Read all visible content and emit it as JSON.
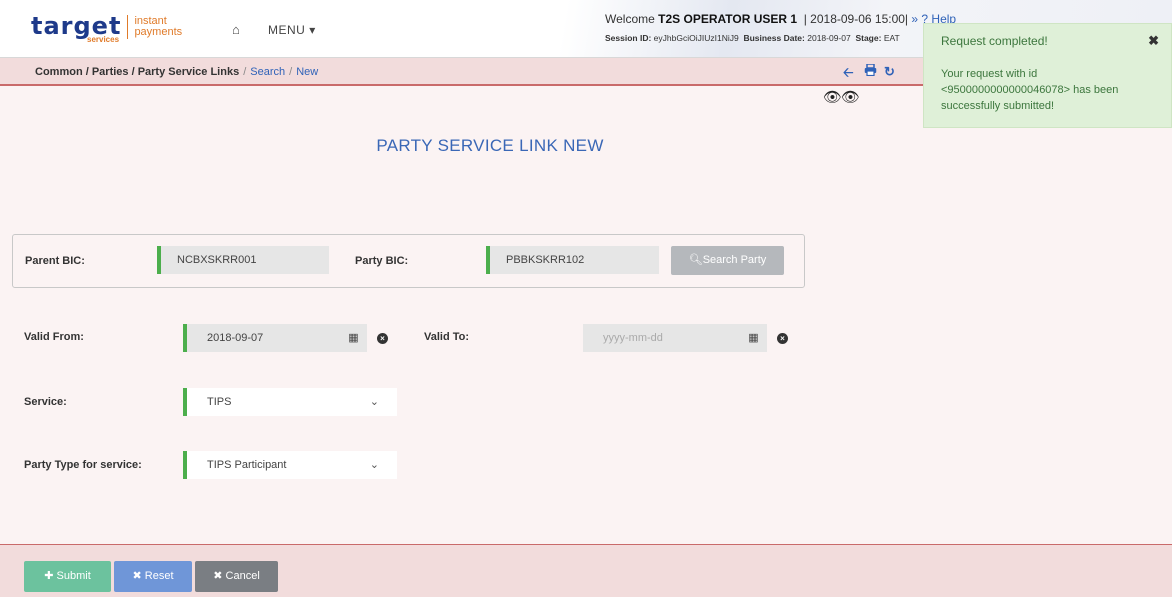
{
  "header": {
    "logo_word": "target",
    "logo_sub": "services",
    "logo_tag_1": "instant",
    "logo_tag_2": "payments",
    "home_icon": "home-icon",
    "menu_label": "MENU",
    "welcome_prefix": "Welcome",
    "user_name": "T2S OPERATOR USER 1",
    "datetime": "| 2018-09-06 15:00|",
    "help_label": "» ? Help",
    "session_label": "Session ID:",
    "session_id": "eyJhbGciOiJIUzI1NiJ9",
    "business_date_label": "Business Date:",
    "business_date": "2018-09-07",
    "stage_label": "Stage:",
    "stage": "EAT"
  },
  "breadcrumb": {
    "path": "Common / Parties / Party Service Links",
    "search": "Search",
    "new": "New"
  },
  "toolbar": {
    "back_icon": "arrow-left-icon",
    "print_icon": "print-icon",
    "refresh_icon": "refresh-icon"
  },
  "page": {
    "title": "PARTY SERVICE LINK NEW"
  },
  "form": {
    "parent_bic_label": "Parent BIC:",
    "parent_bic_value": "NCBXSKRR001",
    "party_bic_label": "Party BIC:",
    "party_bic_value": "PBBKSKRR102",
    "search_party_label": "Search Party",
    "valid_from_label": "Valid From:",
    "valid_from_value": "2018-09-07",
    "valid_to_label": "Valid To:",
    "valid_to_placeholder": "yyyy-mm-dd",
    "service_label": "Service:",
    "service_value": "TIPS",
    "party_type_label": "Party Type for service:",
    "party_type_value": "TIPS Participant"
  },
  "footer": {
    "submit_label": "Submit",
    "reset_label": "Reset",
    "cancel_label": "Cancel"
  },
  "toast": {
    "title": "Request completed!",
    "message": "Your request with id <9500000000000046078> has been successfully submitted!"
  },
  "colors": {
    "accent_blue": "#3a67b6",
    "required_green": "#4cae4c",
    "submit_green": "#6cc29e",
    "reset_blue": "#6f96d8",
    "cancel_gray": "#7a7e83",
    "toast_bg": "#dff0d8"
  }
}
